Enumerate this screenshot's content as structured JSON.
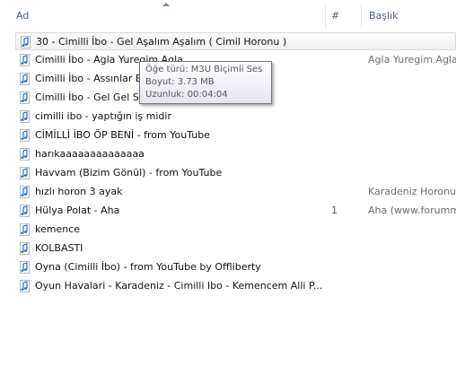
{
  "columns": {
    "name": "Ad",
    "number": "#",
    "title": "Başlık"
  },
  "rows": [
    {
      "name": "30 - Cimilli İbo - Gel Aşalım Aşalım ( Cimil Horonu )",
      "num": "",
      "title": ""
    },
    {
      "name": "Cimilli İbo - Agla Yuregim Agla",
      "num": "",
      "title": "Agla Yuregim Agla"
    },
    {
      "name": "Cimilli İbo - Assınlar B",
      "num": "",
      "title": ""
    },
    {
      "name": "Cimilli İbo - Gel Gel Sib",
      "num": "",
      "title": ""
    },
    {
      "name": "cimilli ibo - yaptığın iş midir",
      "num": "",
      "title": ""
    },
    {
      "name": "CİMİLLİ İBO ÖP BENİ - from YouTube",
      "num": "",
      "title": ""
    },
    {
      "name": "harıkaaaaaaaaaaaaaa",
      "num": "",
      "title": ""
    },
    {
      "name": "Havvam (Bizim Gönül) - from YouTube",
      "num": "",
      "title": ""
    },
    {
      "name": "hızlı horon 3 ayak",
      "num": "",
      "title": "Karadeniz Horonu"
    },
    {
      "name": "Hülya Polat - Aha",
      "num": "1",
      "title": "Aha (www.forumm"
    },
    {
      "name": "kemence",
      "num": "",
      "title": ""
    },
    {
      "name": "KOLBASTI",
      "num": "",
      "title": ""
    },
    {
      "name": "Oyna (Cimilli İbo) - from YouTube by Offliberty",
      "num": "",
      "title": ""
    },
    {
      "name": "Oyun Havalari - Karadeniz - Cimilli Ibo - Kemencem Alli P...",
      "num": "",
      "title": ""
    }
  ],
  "tooltip": {
    "type": "Öğe türü: M3U Biçimli Ses",
    "size": "Boyut: 3.73 MB",
    "length": "Uzunluk: 00:04:04"
  },
  "colors": {
    "header_text": "#4c607a",
    "icon_blue": "#2a6fc4"
  },
  "icon": "audio-file-icon"
}
